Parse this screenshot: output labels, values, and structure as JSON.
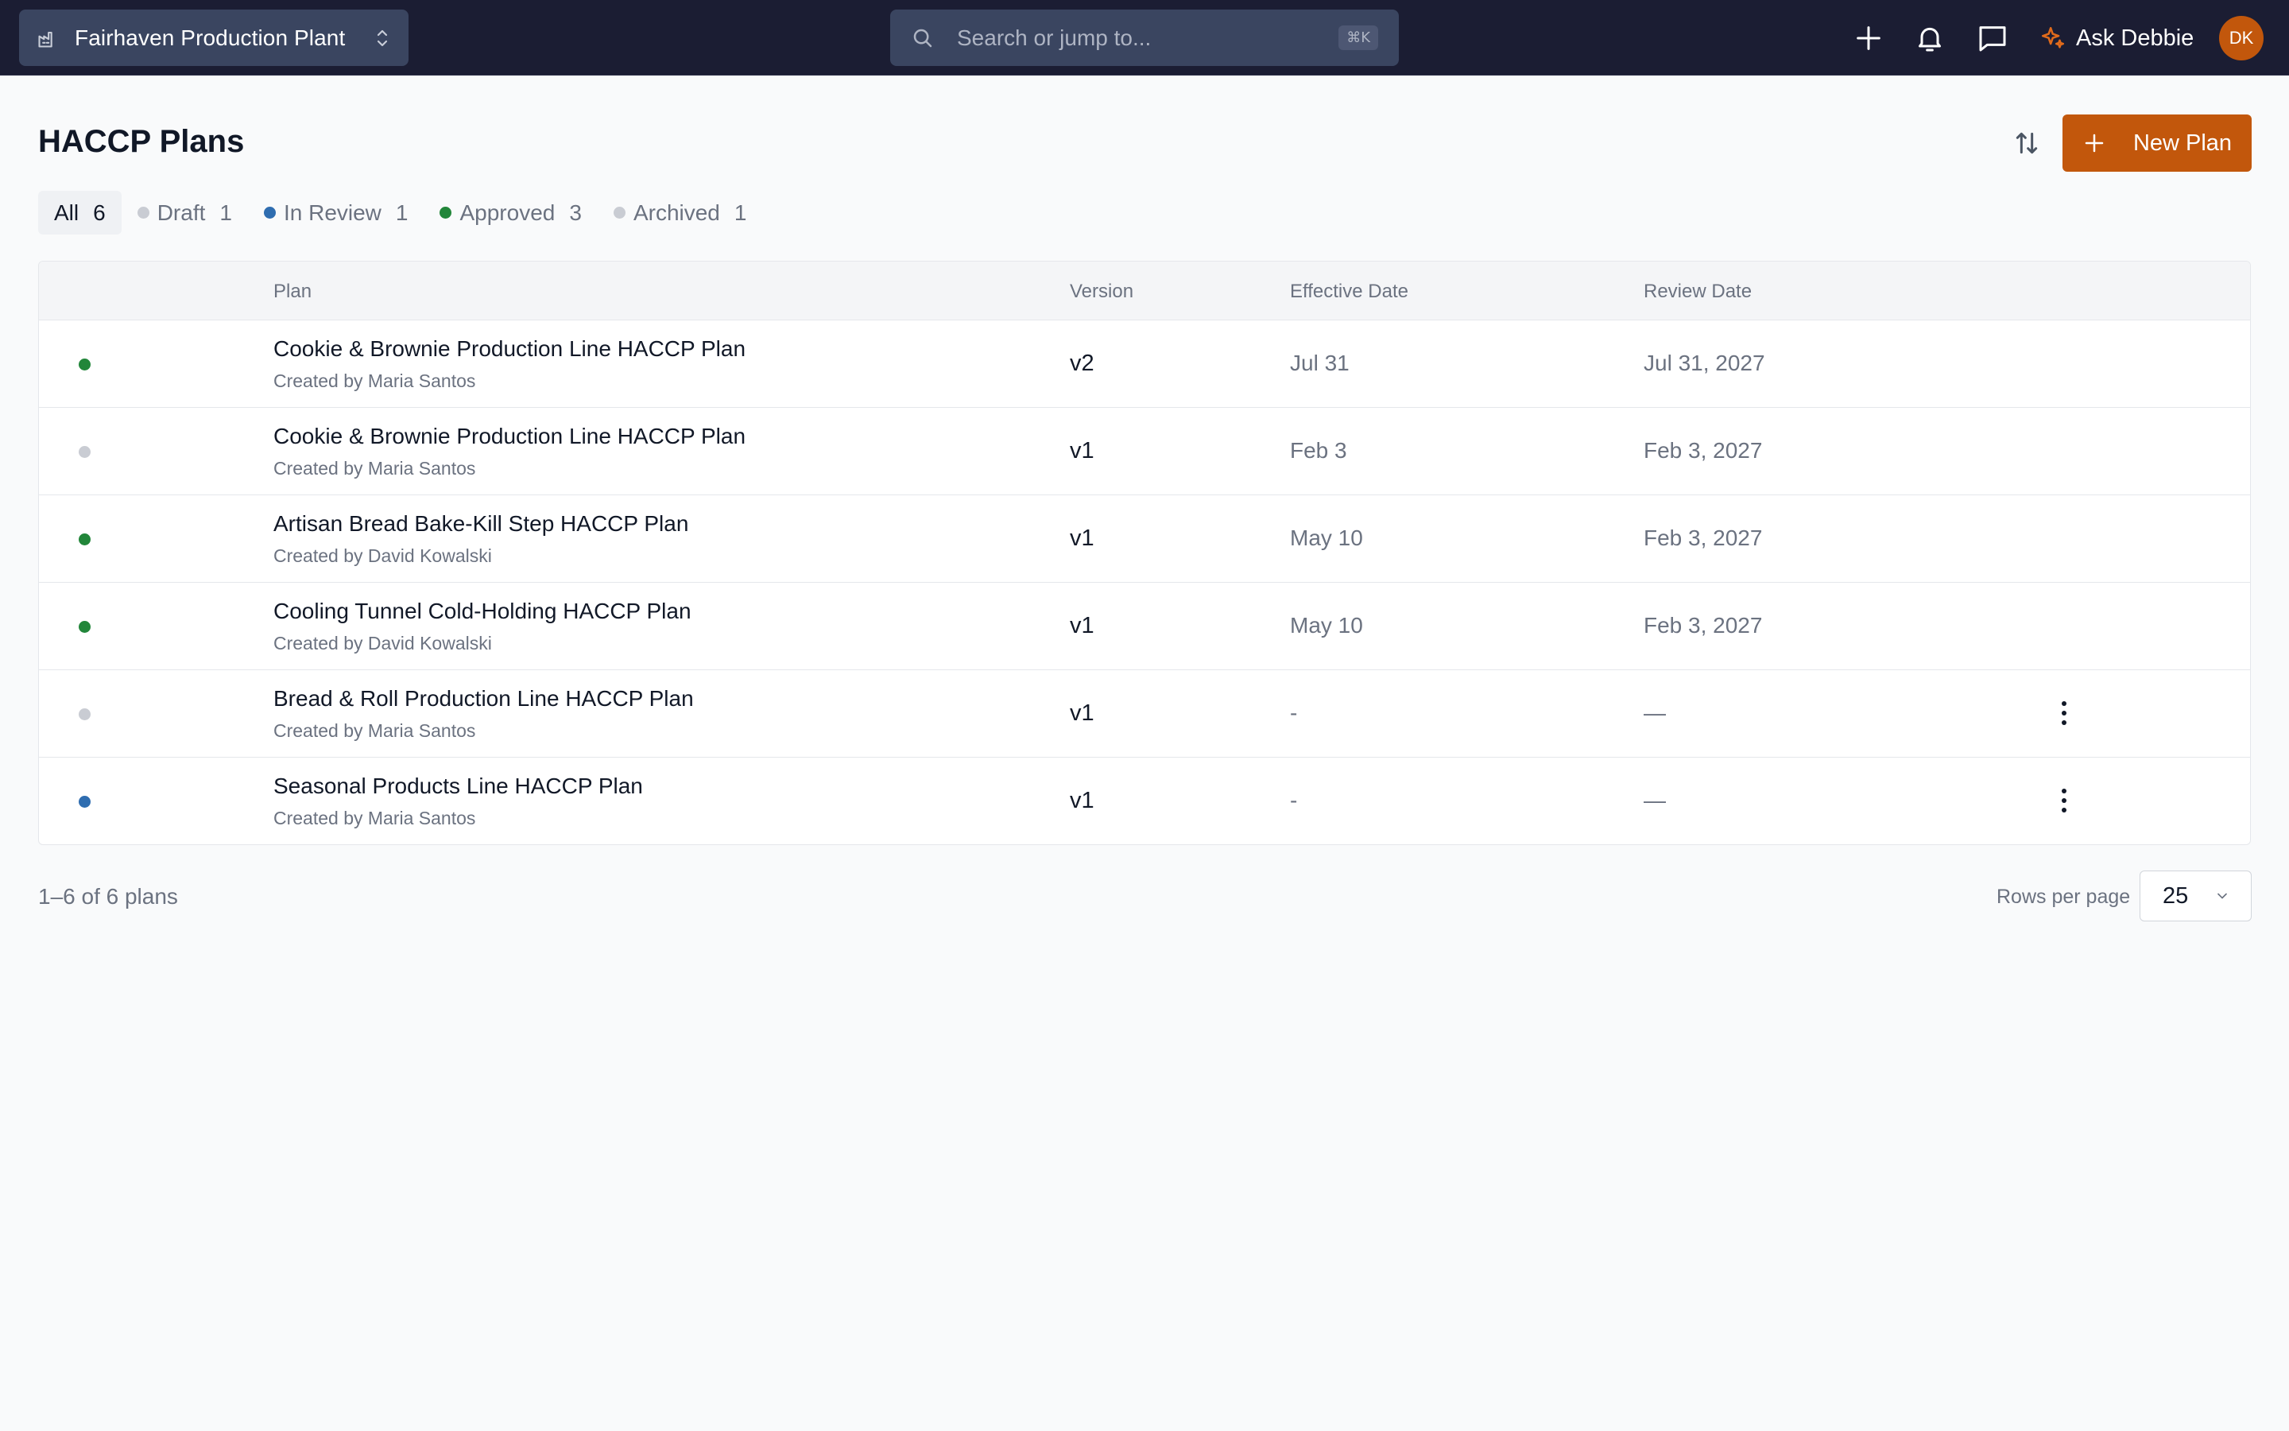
{
  "topbar": {
    "site_name": "Fairhaven Production Plant",
    "search_placeholder": "Search or jump to...",
    "search_shortcut": "⌘K",
    "ask_label": "Ask Debbie",
    "avatar_initials": "DK"
  },
  "page": {
    "title": "HACCP Plans",
    "new_plan_label": "New Plan"
  },
  "filters": [
    {
      "label": "All",
      "count": "6",
      "dot": ""
    },
    {
      "label": "Draft",
      "count": "1",
      "dot": "#c9ccd3"
    },
    {
      "label": "In Review",
      "count": "1",
      "dot": "#2f6db0"
    },
    {
      "label": "Approved",
      "count": "3",
      "dot": "#22863a"
    },
    {
      "label": "Archived",
      "count": "1",
      "dot": "#c9ccd3"
    }
  ],
  "table": {
    "headers": {
      "plan": "Plan",
      "version": "Version",
      "effective": "Effective Date",
      "review": "Review Date"
    },
    "rows": [
      {
        "name": "Cookie & Brownie Production Line HACCP Plan",
        "creator": "Created by Maria Santos",
        "version": "v2",
        "effective": "Jul 31",
        "review": "Jul 31, 2027",
        "status_color": "#22863a",
        "menu": false
      },
      {
        "name": "Cookie & Brownie Production Line HACCP Plan",
        "creator": "Created by Maria Santos",
        "version": "v1",
        "effective": "Feb 3",
        "review": "Feb 3, 2027",
        "status_color": "#c9ccd3",
        "menu": false
      },
      {
        "name": "Artisan Bread Bake-Kill Step HACCP Plan",
        "creator": "Created by David Kowalski",
        "version": "v1",
        "effective": "May 10",
        "review": "Feb 3, 2027",
        "status_color": "#22863a",
        "menu": false
      },
      {
        "name": "Cooling Tunnel Cold-Holding HACCP Plan",
        "creator": "Created by David Kowalski",
        "version": "v1",
        "effective": "May 10",
        "review": "Feb 3, 2027",
        "status_color": "#22863a",
        "menu": false
      },
      {
        "name": "Bread & Roll Production Line HACCP Plan",
        "creator": "Created by Maria Santos",
        "version": "v1",
        "effective": "-",
        "review": "—",
        "status_color": "#c9ccd3",
        "menu": true
      },
      {
        "name": "Seasonal Products Line HACCP Plan",
        "creator": "Created by Maria Santos",
        "version": "v1",
        "effective": "-",
        "review": "—",
        "status_color": "#2f6db0",
        "menu": true
      }
    ]
  },
  "footer": {
    "summary": "1–6 of 6 plans",
    "rows_per_page_label": "Rows per page",
    "rows_per_page_value": "25"
  },
  "colors": {
    "topbar": "#1b1d33",
    "accent": "#c2570c",
    "approved": "#22863a",
    "in_review": "#2f6db0",
    "draft": "#c9ccd3"
  }
}
